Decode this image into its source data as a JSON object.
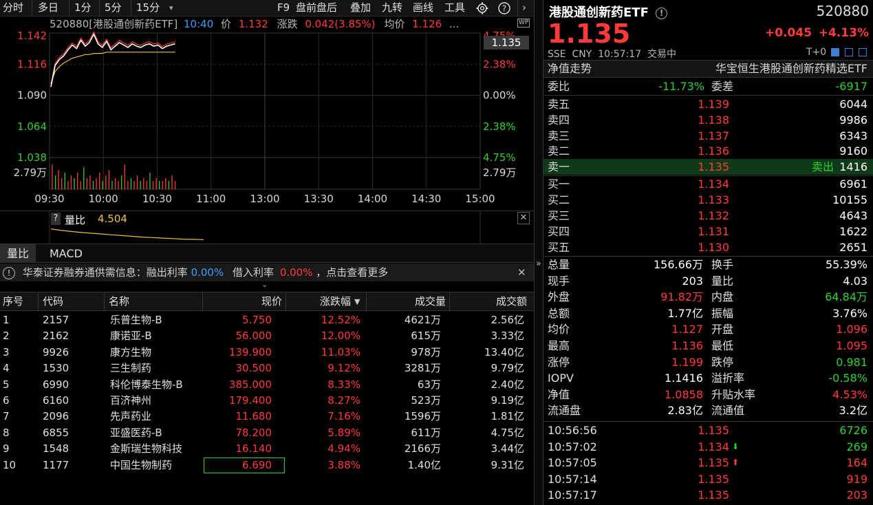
{
  "toolbar": {
    "items": [
      "分时",
      "多日",
      "1分",
      "5分",
      "15分",
      "F9",
      "盘前盘后",
      "叠加",
      "九转",
      "画线",
      "工具"
    ]
  },
  "chart_header": {
    "code_name": "520880[港股通创新药ETF]",
    "time": "10:40",
    "price_label": "价",
    "price": "1.132",
    "change_label": "涨跌",
    "change": "0.042(3.85%)",
    "avg_label": "均价",
    "avg": "1.126",
    "more": "..."
  },
  "chart_data": {
    "type": "line",
    "x_ticks": [
      "09:30",
      "10:00",
      "10:30",
      "11:00",
      "13:00",
      "13:30",
      "14:00",
      "14:30",
      "15:00"
    ],
    "y_ticks_left": [
      "1.142",
      "1.116",
      "1.090",
      "1.064",
      "1.038"
    ],
    "y_ticks_right": [
      "4.75%",
      "2.38%",
      "0.00%",
      "2.38%",
      "4.75%"
    ],
    "volume_tick": "2.79万",
    "current_price_tag": "1.135",
    "ylim": [
      1.038,
      1.142
    ],
    "price_series": [
      1.097,
      1.115,
      1.12,
      1.123,
      1.128,
      1.132,
      1.129,
      1.136,
      1.131,
      1.134,
      1.141,
      1.133,
      1.13,
      1.135,
      1.128,
      1.131,
      1.134,
      1.132,
      1.13,
      1.133,
      1.131,
      1.13,
      1.132,
      1.133,
      1.131,
      1.132,
      1.129,
      1.131,
      1.132,
      1.133
    ],
    "avg_series": [
      1.1,
      1.11,
      1.114,
      1.117,
      1.119,
      1.121,
      1.122,
      1.123,
      1.124,
      1.124,
      1.125,
      1.125,
      1.125,
      1.126,
      1.126,
      1.126,
      1.126,
      1.126,
      1.126,
      1.126,
      1.126,
      1.126,
      1.126,
      1.126,
      1.126,
      1.126,
      1.126,
      1.126,
      1.126,
      1.126
    ],
    "volume_series": [
      0.9,
      0.5,
      0.7,
      0.4,
      0.6,
      0.3,
      0.5,
      0.4,
      0.6,
      0.3,
      0.8,
      0.4,
      0.5,
      0.3,
      0.4,
      0.6,
      0.3,
      0.5,
      0.7,
      0.3,
      0.4,
      0.3,
      0.5,
      0.9,
      0.3,
      0.4,
      0.3,
      0.5,
      0.3,
      0.4,
      0.3,
      0.6,
      0.3,
      0.4,
      0.3,
      0.3,
      0.4,
      0.3,
      0.5,
      0.3
    ]
  },
  "sub_chart": {
    "help": "?",
    "label": "量比",
    "value": "4.504",
    "ratio_series": [
      4.9,
      4.84,
      4.8,
      4.76,
      4.73,
      4.7,
      4.67,
      4.64,
      4.61,
      4.58,
      4.56,
      4.54,
      4.52,
      4.5,
      4.49,
      4.48
    ]
  },
  "tabs": [
    "量比",
    "MACD"
  ],
  "notice": {
    "text1": "华泰证券融券通供需信息：融出利率",
    "rate1": "0.00%",
    "text2": "借入利率",
    "rate2": "0.00%",
    "text3": "，点击查看更多"
  },
  "table": {
    "headers": [
      "序号",
      "代码",
      "名称",
      "现价",
      "涨跌幅",
      "成交量",
      "成交额"
    ],
    "rows": [
      [
        "1",
        "2157",
        "乐普生物-B",
        "5.750",
        "12.52%",
        "4621万",
        "2.56亿"
      ],
      [
        "2",
        "2162",
        "康诺亚-B",
        "56.000",
        "12.00%",
        "615万",
        "3.33亿"
      ],
      [
        "3",
        "9926",
        "康方生物",
        "139.900",
        "11.03%",
        "978万",
        "13.40亿"
      ],
      [
        "4",
        "1530",
        "三生制药",
        "30.500",
        "9.12%",
        "3281万",
        "9.79亿"
      ],
      [
        "5",
        "6990",
        "科伦博泰生物-B",
        "385.000",
        "8.33%",
        "63万",
        "2.40亿"
      ],
      [
        "6",
        "6160",
        "百济神州",
        "179.400",
        "8.27%",
        "523万",
        "9.19亿"
      ],
      [
        "7",
        "2096",
        "先声药业",
        "11.680",
        "7.16%",
        "1596万",
        "1.81亿"
      ],
      [
        "8",
        "6855",
        "亚盛医药-B",
        "78.200",
        "5.89%",
        "611万",
        "4.75亿"
      ],
      [
        "9",
        "1548",
        "金斯瑞生物科技",
        "16.140",
        "4.94%",
        "2166万",
        "3.44亿"
      ],
      [
        "10",
        "1177",
        "中国生物制药",
        "6.690",
        "3.88%",
        "1.40亿",
        "9.31亿"
      ]
    ]
  },
  "quote": {
    "name": "港股通创新药ETF",
    "code": "520880",
    "price": "1.135",
    "change": "+0.045",
    "change_pct": "+4.13%",
    "market_line": "SSE  CNY  10:57:17  交易中",
    "t0": "T+0",
    "nav_trend": "净值走势",
    "fund_name": "华宝恒生港股通创新药精选ETF",
    "weibi_label": "委比",
    "weibi": "-11.73%",
    "weicha_label": "委差",
    "weicha": "-6917",
    "asks": [
      {
        "label": "卖五",
        "price": "1.139",
        "vol": "6044"
      },
      {
        "label": "卖四",
        "price": "1.138",
        "vol": "9986"
      },
      {
        "label": "卖三",
        "price": "1.137",
        "vol": "6343"
      },
      {
        "label": "卖二",
        "price": "1.136",
        "vol": "9160"
      },
      {
        "label": "卖一",
        "price": "1.135",
        "vol": "1416",
        "tag": "卖出"
      }
    ],
    "bids": [
      {
        "label": "买一",
        "price": "1.134",
        "vol": "6961"
      },
      {
        "label": "买二",
        "price": "1.133",
        "vol": "10155"
      },
      {
        "label": "买三",
        "price": "1.132",
        "vol": "4643"
      },
      {
        "label": "买四",
        "price": "1.131",
        "vol": "1622"
      },
      {
        "label": "买五",
        "price": "1.130",
        "vol": "2651"
      }
    ],
    "stats": [
      [
        "总量",
        "156.66万",
        "换手",
        "55.39%"
      ],
      [
        "现手",
        "203",
        "量比",
        "4.03"
      ],
      [
        "外盘",
        "91.82万",
        "内盘",
        "64.84万"
      ],
      [
        "总额",
        "1.77亿",
        "振幅",
        "3.76%"
      ],
      [
        "均价",
        "1.127",
        "开盘",
        "1.096"
      ],
      [
        "最高",
        "1.136",
        "最低",
        "1.095"
      ],
      [
        "涨停",
        "1.199",
        "跌停",
        "0.981"
      ],
      [
        "IOPV",
        "1.1416",
        "溢折率",
        "-0.58%"
      ],
      [
        "净值",
        "1.0858",
        "升贴水率",
        "4.53%"
      ],
      [
        "流通盘",
        "2.83亿",
        "流通值",
        "3.2亿"
      ]
    ],
    "ticks": [
      [
        "10:56:56",
        "1.135",
        "",
        "6726"
      ],
      [
        "10:57:02",
        "1.134",
        "down",
        "269"
      ],
      [
        "10:57:05",
        "1.135",
        "up",
        "164"
      ],
      [
        "10:57:14",
        "1.135",
        "",
        "919"
      ],
      [
        "10:57:17",
        "1.135",
        "",
        "203"
      ]
    ]
  },
  "colors": {
    "up": "#ff3b3b",
    "down": "#2fd12f",
    "price_line": "#ffffff",
    "avg_line": "#f0c040",
    "volume": "#ff3b3b"
  }
}
